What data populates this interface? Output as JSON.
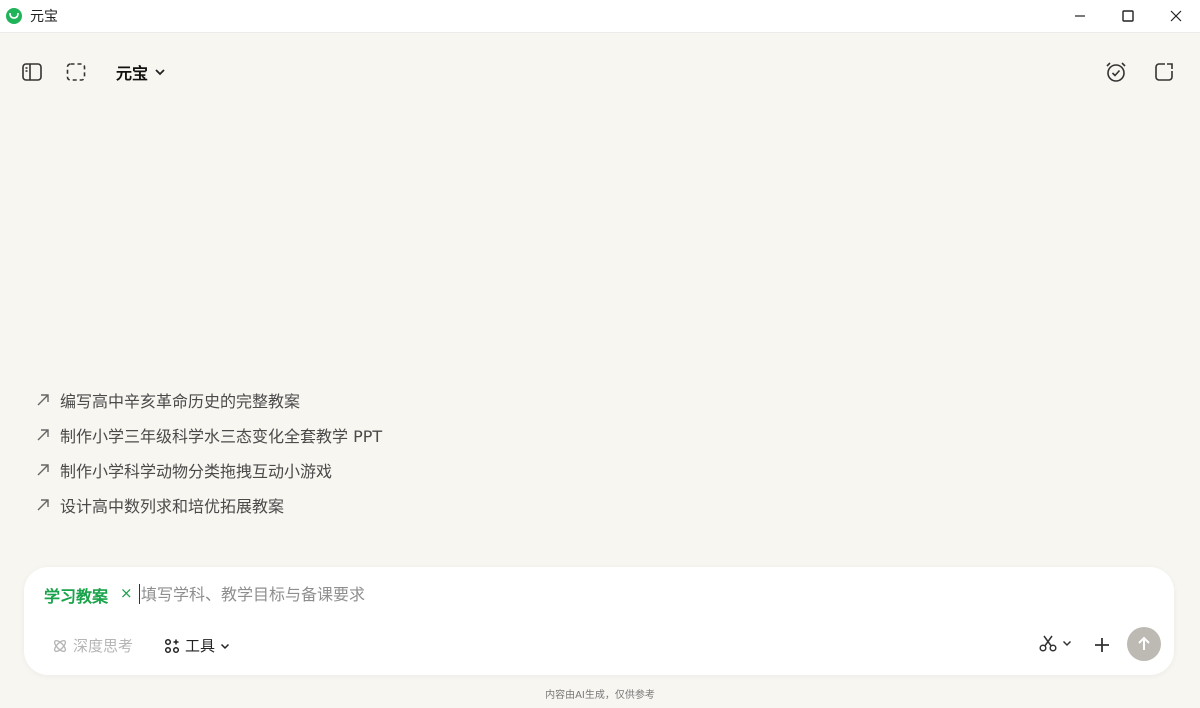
{
  "window": {
    "title": "元宝"
  },
  "header": {
    "model_name": "元宝"
  },
  "suggestions": [
    {
      "text": "编写高中辛亥革命历史的完整教案"
    },
    {
      "text": "制作小学三年级科学水三态变化全套教学 PPT"
    },
    {
      "text": "制作小学科学动物分类拖拽互动小游戏"
    },
    {
      "text": "设计高中数列求和培优拓展教案"
    }
  ],
  "composer": {
    "tag_label": "学习教案",
    "tag_close": "×",
    "placeholder": "填写学科、教学目标与备课要求",
    "deep_think_label": "深度思考",
    "tools_label": "工具"
  },
  "footer": {
    "disclaimer": "内容由AI生成，仅供参考"
  },
  "colors": {
    "background": "#f8f6f1",
    "accent_green": "#1aa34a",
    "send_button": "#bdb9b3"
  },
  "icons": {
    "app_logo": "yuanbao-logo-icon",
    "sidebar_toggle": "sidebar-icon",
    "screenshot": "dashed-select-icon",
    "alarm": "alarm-clock-icon",
    "new_chat": "new-chat-icon",
    "suggestion_arrow": "arrow-up-right-icon",
    "deep_think": "atom-icon",
    "tools": "grid-dots-icon",
    "scissor": "scissors-icon",
    "add": "plus-icon",
    "send": "arrow-up-icon"
  }
}
